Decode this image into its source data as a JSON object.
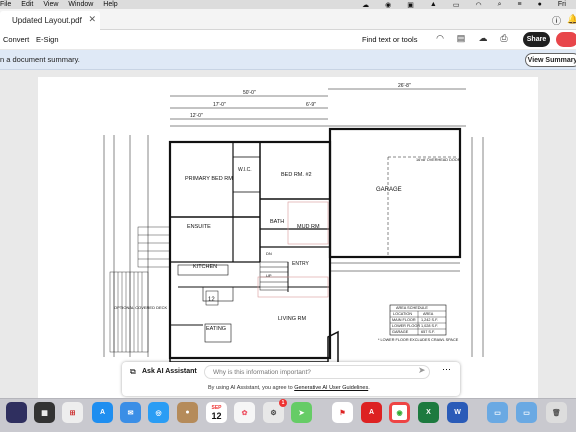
{
  "menubar": {
    "items": [
      "File",
      "Edit",
      "View",
      "Window",
      "Help"
    ],
    "clock": "Fri"
  },
  "tab": {
    "title": "Updated Layout.pdf"
  },
  "toolbar": {
    "convert": "Convert",
    "esign": "E-Sign",
    "find": "Find text or tools",
    "share": "Share"
  },
  "banner": {
    "text": "n a document summary.",
    "button": "View Summary"
  },
  "plan": {
    "dims_top": [
      "50'-0\"",
      "17'-0\"",
      "6'-9\"",
      "12'-0\"",
      "26'-8\""
    ],
    "rooms": [
      "PRIMARY BED RM",
      "W.I.C.",
      "BED RM. #2",
      "GARAGE",
      "ENSUITE",
      "BATH",
      "MUD RM",
      "KITCHEN",
      "ENTRY",
      "EATING",
      "LIVING RM",
      "OPTIONAL COVERED DECK",
      "UP",
      "DN"
    ],
    "schedule": {
      "title": "AREA SCHEDULE",
      "header": [
        "LOCATION",
        "AREA"
      ],
      "rows": [
        [
          "MAIN FLOOR",
          "1,242 S.F."
        ],
        [
          "LOWER FLOOR",
          "1,028 S.F."
        ],
        [
          "GARAGE",
          "657 S.F."
        ]
      ],
      "note": "* LOWER FLOOR EXCLUDES CRAWL SPACE"
    },
    "garage_note": "16'x8' OVERHEAD DOOR",
    "range": "12"
  },
  "ai": {
    "label": "Ask AI Assistant",
    "placeholder": "Why is this information important?",
    "terms": "By using AI Assistant, you agree to ",
    "terms_link": "Generative AI User Guidelines"
  },
  "dock": {
    "calendar_month": "SEP",
    "calendar_day": "12",
    "settings_badge": "1"
  }
}
